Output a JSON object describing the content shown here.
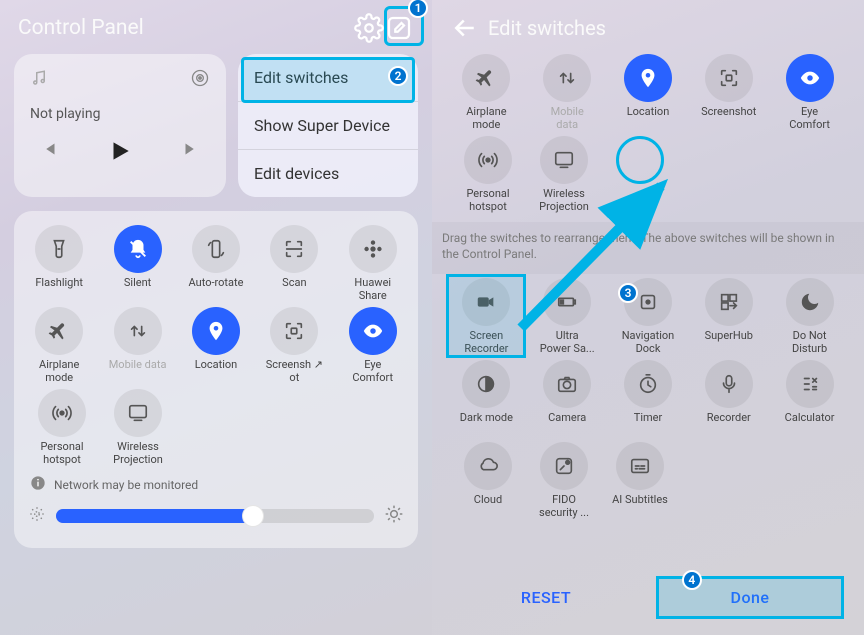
{
  "left": {
    "title": "Control Panel",
    "media": {
      "status": "Not playing"
    },
    "menu": [
      "Edit switches",
      "Show Super Device",
      "Edit devices"
    ],
    "switches_top": [
      {
        "label": "Flashlight",
        "icon": "flashlight",
        "active": false
      },
      {
        "label": "Silent",
        "icon": "bell-off",
        "active": true
      },
      {
        "label": "Auto-rotate",
        "icon": "rotate",
        "active": false
      },
      {
        "label": "Scan",
        "icon": "scan",
        "active": false
      },
      {
        "label": "Huawei\nShare",
        "icon": "share-dots",
        "active": false
      }
    ],
    "switches_mid": [
      {
        "label": "Airplane\nmode",
        "icon": "plane",
        "active": false
      },
      {
        "label": "Mobile data",
        "icon": "mobile-data",
        "active": false,
        "disabled": true
      },
      {
        "label": "Location",
        "icon": "location",
        "active": true
      },
      {
        "label": "Screensh ↗\not",
        "icon": "screenshot",
        "active": false
      },
      {
        "label": "Eye\nComfort",
        "icon": "eye",
        "active": true
      }
    ],
    "switches_bot": [
      {
        "label": "Personal\nhotspot",
        "icon": "hotspot",
        "active": false
      },
      {
        "label": "Wireless\nProjection",
        "icon": "cast",
        "active": false
      }
    ],
    "network_note": "Network may be monitored",
    "brightness_pct": 62
  },
  "right": {
    "title": "Edit switches",
    "row1": [
      {
        "label": "Airplane\nmode",
        "icon": "plane",
        "active": false
      },
      {
        "label": "Mobile\ndata",
        "icon": "mobile-data",
        "active": false,
        "disabled": true
      },
      {
        "label": "Location",
        "icon": "location",
        "active": true
      },
      {
        "label": "Screenshot",
        "icon": "screenshot",
        "active": false
      },
      {
        "label": "Eye\nComfort",
        "icon": "eye",
        "active": true
      }
    ],
    "row2": [
      {
        "label": "Personal\nhotspot",
        "icon": "hotspot",
        "active": false
      },
      {
        "label": "Wireless\nProjection",
        "icon": "cast",
        "active": false
      },
      {
        "label": "",
        "icon": "empty",
        "empty": true
      }
    ],
    "drag_hint": "Drag the switches to rearrange them. The above switches will be shown in the Control Panel.",
    "row3": [
      {
        "label": "Screen\nRecorder",
        "icon": "cam-rec",
        "highlight": true
      },
      {
        "label": "Ultra\nPower Sa...",
        "icon": "battery-low"
      },
      {
        "label": "Navigation\nDock",
        "icon": "nav-dock"
      },
      {
        "label": "SuperHub",
        "icon": "superhub"
      },
      {
        "label": "Do Not\nDisturb",
        "icon": "moon"
      }
    ],
    "row4": [
      {
        "label": "Dark mode",
        "icon": "dark"
      },
      {
        "label": "Camera",
        "icon": "camera"
      },
      {
        "label": "Timer",
        "icon": "timer"
      },
      {
        "label": "Recorder",
        "icon": "mic"
      },
      {
        "label": "Calculator",
        "icon": "calc"
      }
    ],
    "row5": [
      {
        "label": "Cloud",
        "icon": "cloud"
      },
      {
        "label": "FIDO\nsecurity ...",
        "icon": "fido"
      },
      {
        "label": "AI Subtitles",
        "icon": "subtitles"
      }
    ],
    "reset": "RESET",
    "done": "Done"
  },
  "badges": [
    "1",
    "2",
    "3",
    "4"
  ]
}
